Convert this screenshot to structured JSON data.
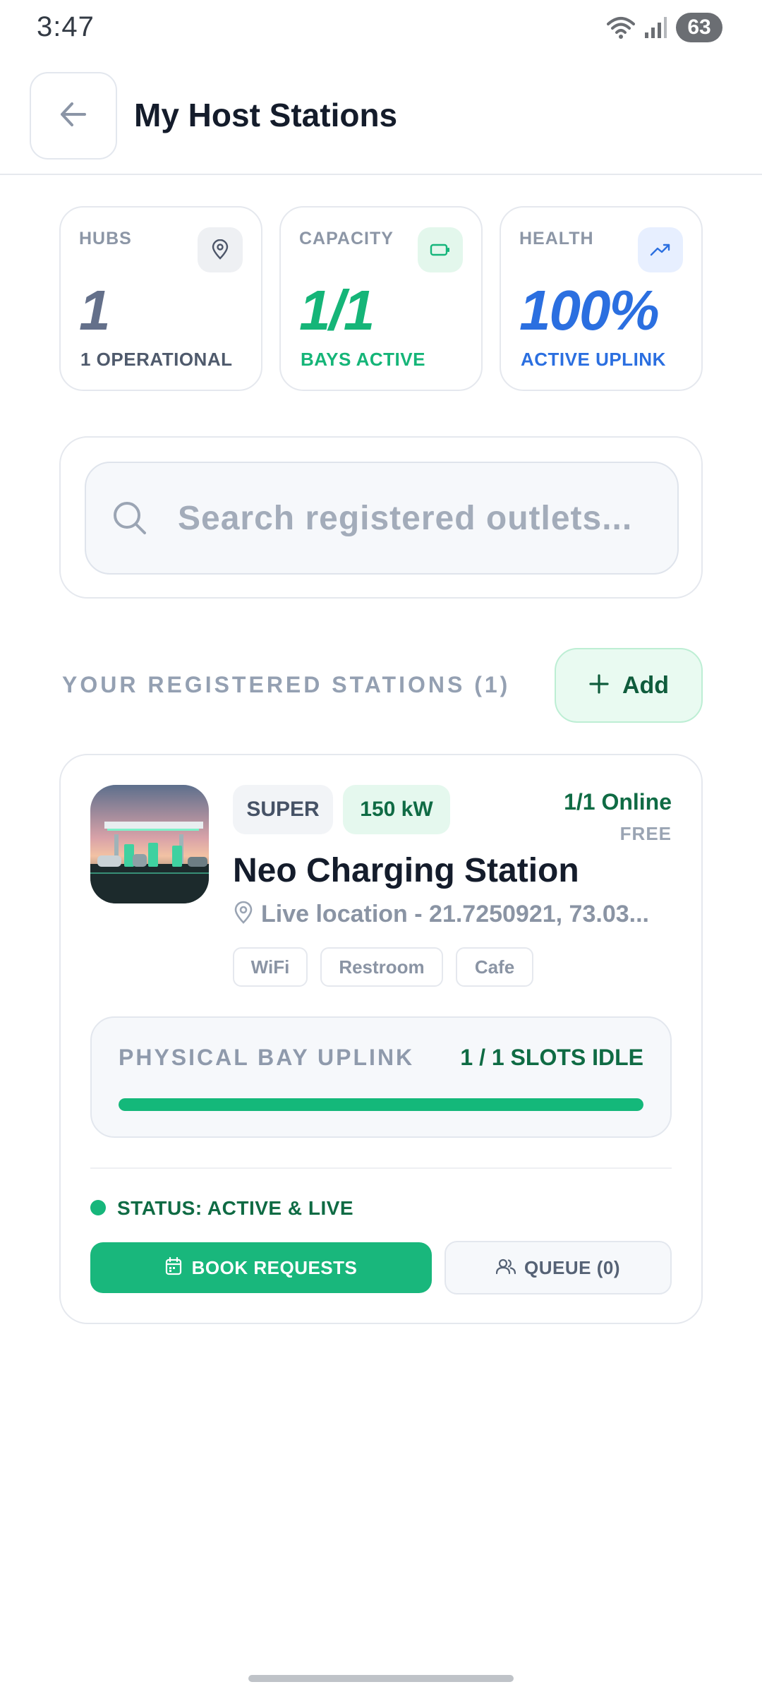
{
  "status_bar": {
    "time": "3:47",
    "battery": "63"
  },
  "header": {
    "title": "My Host Stations"
  },
  "stats": {
    "hubs": {
      "label": "HUBS",
      "value": "1",
      "sub": "1 OPERATIONAL",
      "icon": "map-pin-icon",
      "color": "#64708a"
    },
    "capacity": {
      "label": "CAPACITY",
      "value": "1/1",
      "sub": "BAYS ACTIVE",
      "icon": "battery-icon",
      "color": "#15b578"
    },
    "health": {
      "label": "HEALTH",
      "value": "100%",
      "sub": "ACTIVE UPLINK",
      "icon": "trending-up-icon",
      "color": "#2b6fe0"
    }
  },
  "search": {
    "placeholder": "Search registered outlets...",
    "value": ""
  },
  "section": {
    "title": "YOUR REGISTERED STATIONS (1)",
    "add_label": "Add"
  },
  "station": {
    "type": "SUPER",
    "power": "150 kW",
    "online": "1/1 Online",
    "price": "FREE",
    "name": "Neo Charging Station",
    "location": "Live location - 21.7250921, 73.03...",
    "amenities": [
      "WiFi",
      "Restroom",
      "Cafe"
    ],
    "uplink": {
      "title": "PHYSICAL BAY UPLINK",
      "status": "1 / 1 SLOTS IDLE",
      "fill_fraction": 1.0
    },
    "status": "STATUS: ACTIVE & LIVE",
    "book_label": "BOOK REQUESTS",
    "queue_label": "QUEUE (0)"
  },
  "colors": {
    "accent_green": "#19b77c",
    "dark_green": "#0f6b44",
    "health_blue": "#2b6fe0"
  }
}
